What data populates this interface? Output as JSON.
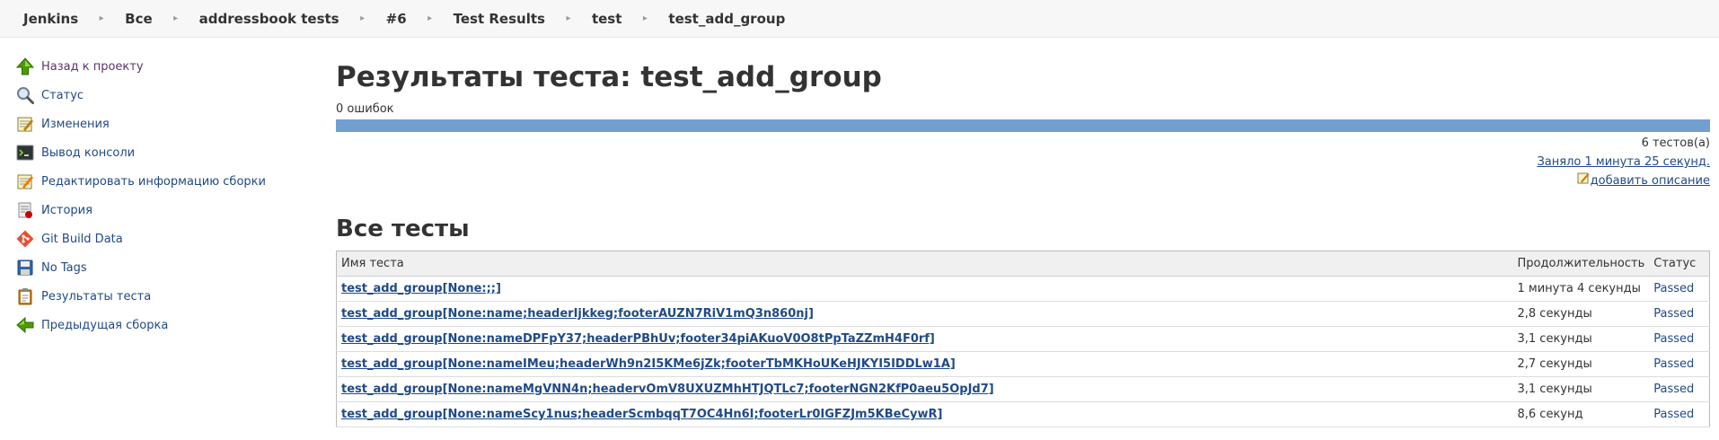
{
  "breadcrumb": [
    "Jenkins",
    "Все",
    "addressbook tests",
    "#6",
    "Test Results",
    "test",
    "test_add_group"
  ],
  "sidebar": {
    "items": [
      {
        "label": "Назад к проекту",
        "icon": "up-arrow-icon"
      },
      {
        "label": "Статус",
        "icon": "magnifier-icon"
      },
      {
        "label": "Изменения",
        "icon": "notepad-icon"
      },
      {
        "label": "Вывод консоли",
        "icon": "terminal-icon"
      },
      {
        "label": "Редактировать информацию сборки",
        "icon": "edit-notepad-icon"
      },
      {
        "label": "История",
        "icon": "history-icon"
      },
      {
        "label": "Git Build Data",
        "icon": "git-icon"
      },
      {
        "label": "No Tags",
        "icon": "save-icon"
      },
      {
        "label": "Результаты теста",
        "icon": "clipboard-icon"
      },
      {
        "label": "Предыдущая сборка",
        "icon": "left-arrow-icon"
      }
    ]
  },
  "main": {
    "title": "Результаты теста: test_add_group",
    "failures": "0 ошибок",
    "progress": {
      "passed_fraction": 1.0,
      "color": "#729fcf"
    },
    "test_count": "6 тестов(а)",
    "duration_link": "Заняло 1 минута 25 секунд.",
    "add_description": "добавить описание",
    "section_title": "Все тесты",
    "table": {
      "headers": [
        "Имя теста",
        "Продолжительность",
        "Статус"
      ],
      "rows": [
        {
          "name": "test_add_group[None:;;]",
          "duration": "1 минута 4 секунды",
          "status": "Passed"
        },
        {
          "name": "test_add_group[None:name;headerIjkkeg;footerAUZN7RiV1mQ3n860nj]",
          "duration": "2,8 секунды",
          "status": "Passed"
        },
        {
          "name": "test_add_group[None:nameDPFpY37;headerPBhUv;footer34piAKuoV0O8tPpTaZZmH4F0rf]",
          "duration": "3,1 секунды",
          "status": "Passed"
        },
        {
          "name": "test_add_group[None:nameIMeu;headerWh9n2I5KMe6jZk;footerTbMKHoUKeHJKYI5IDDLw1A]",
          "duration": "2,7 секунды",
          "status": "Passed"
        },
        {
          "name": "test_add_group[None:nameMgVNN4n;headervOmV8UXUZMhHTJQTLc7;footerNGN2KfP0aeu5OpJd7]",
          "duration": "3,1 секунды",
          "status": "Passed"
        },
        {
          "name": "test_add_group[None:nameScy1nus;headerScmbqqT7OC4Hn6I;footerLr0IGFZJm5KBeCywR]",
          "duration": "8,6 секунд",
          "status": "Passed"
        }
      ]
    }
  }
}
